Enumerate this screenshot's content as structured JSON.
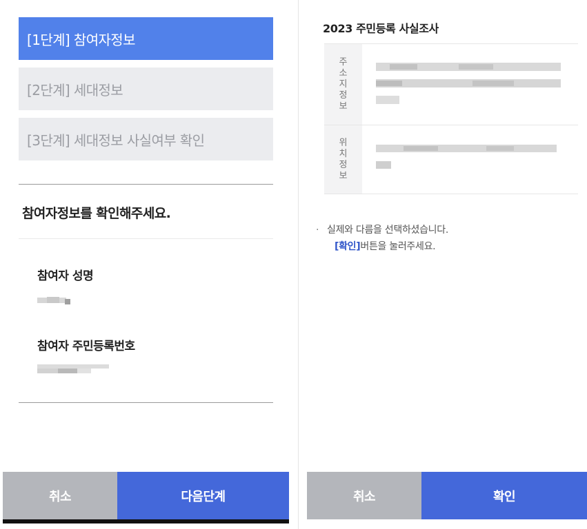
{
  "steps": [
    {
      "label": "[1단계] 참여자정보",
      "active": true
    },
    {
      "label": "[2단계] 세대정보",
      "active": false
    },
    {
      "label": "[3단계] 세대정보 사실여부 확인",
      "active": false
    }
  ],
  "participant": {
    "section_title": "참여자정보를 확인해주세요.",
    "name_label": "참여자 성명",
    "id_label": "참여자 주민등록번호"
  },
  "left_buttons": {
    "cancel": "취소",
    "next": "다음단계"
  },
  "survey": {
    "title": "2023 주민등록 사실조사",
    "address_head": "주소지정보",
    "location_head": "위치정보"
  },
  "notice": {
    "line1": "실제와 다름을 선택하셨습니다.",
    "line2_accent": "[확인]",
    "line2_rest": "버튼을 눌러주세요."
  },
  "right_buttons": {
    "cancel": "취소",
    "confirm": "확인"
  },
  "colors": {
    "active_step": "#5181ea",
    "inactive_step": "#ebecef",
    "primary_button": "#4468da",
    "secondary_button": "#b4b6bb",
    "accent_text": "#2f55c9"
  }
}
